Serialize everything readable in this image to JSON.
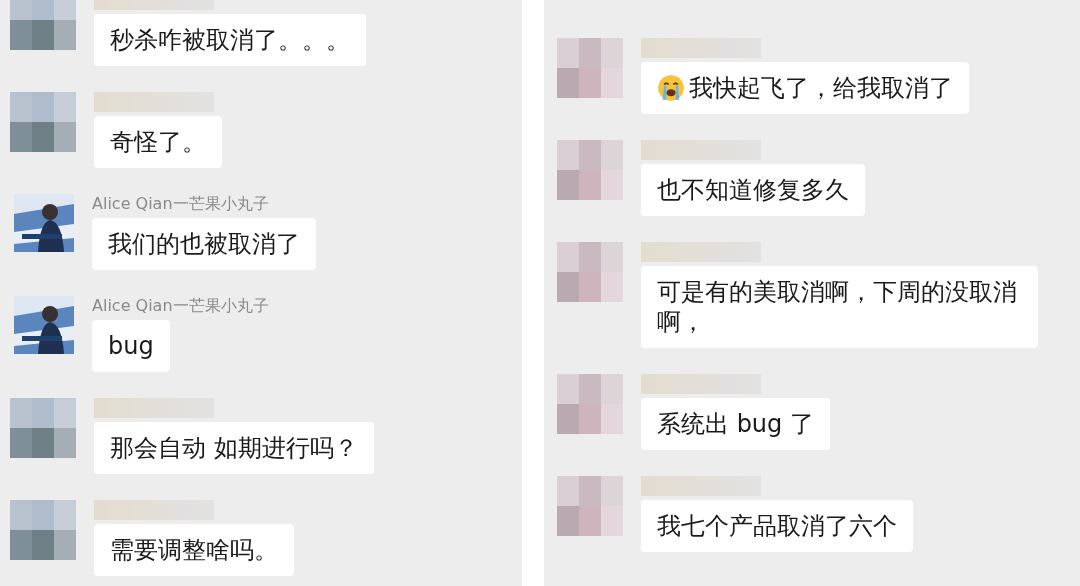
{
  "panels": [
    {
      "messages": [
        {
          "kind": "blurred",
          "text": "秒杀咋被取消了。。。"
        },
        {
          "kind": "blurred",
          "text": "奇怪了。"
        },
        {
          "kind": "illustration",
          "sender": "Alice Qian一芒果小丸子",
          "text": "我们的也被取消了"
        },
        {
          "kind": "illustration",
          "sender": "Alice Qian一芒果小丸子",
          "text": "bug"
        },
        {
          "kind": "blurred",
          "text": "那会自动  如期进行吗？"
        },
        {
          "kind": "blurred",
          "text": "需要调整啥吗。"
        }
      ]
    },
    {
      "messages": [
        {
          "kind": "blurred",
          "emoji": true,
          "text": "我快起飞了，给我取消了"
        },
        {
          "kind": "blurred",
          "text": "也不知道修复多久"
        },
        {
          "kind": "blurred",
          "text": "可是有的美取消啊，下周的没取消啊，"
        },
        {
          "kind": "blurred",
          "text": "系统出 bug 了"
        },
        {
          "kind": "blurred",
          "text": "我七个产品取消了六个"
        }
      ]
    }
  ]
}
